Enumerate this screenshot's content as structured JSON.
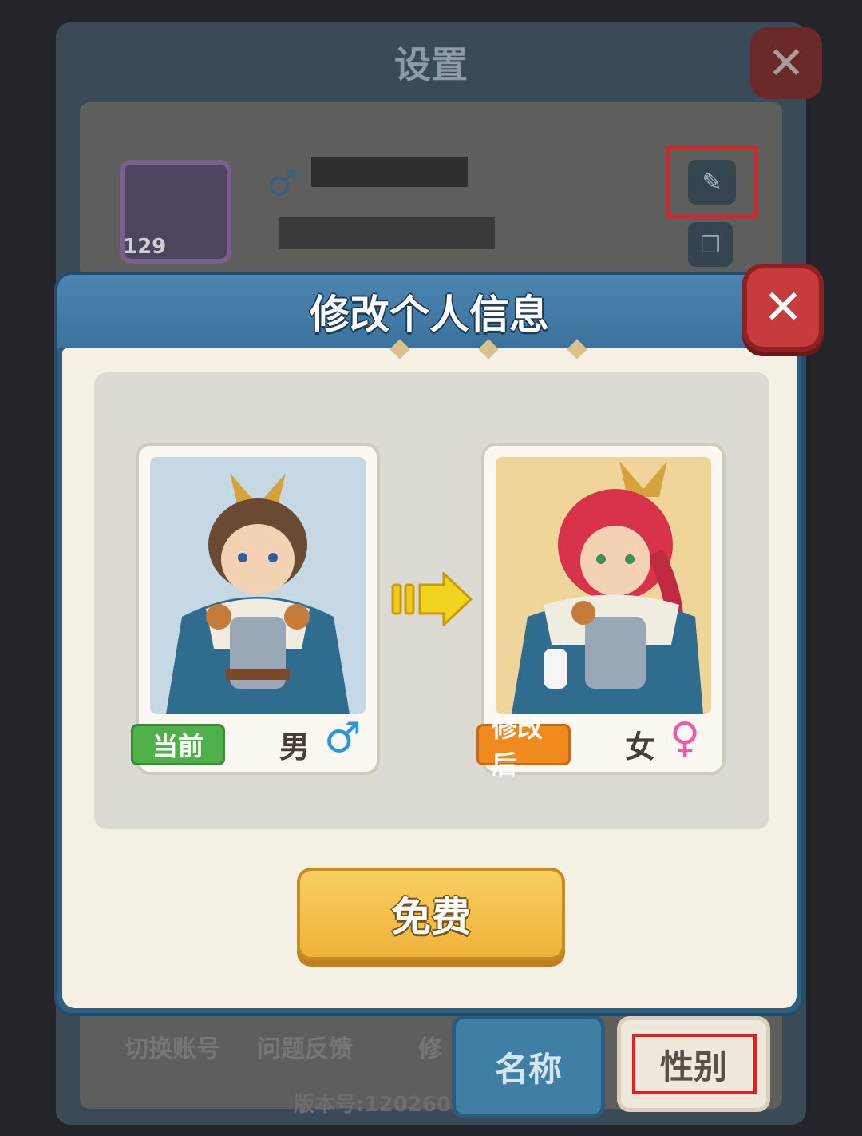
{
  "background_settings": {
    "title": "设置",
    "close_icon": "close-icon",
    "player_level": "129",
    "gender_icon": "♂",
    "bottom_links": [
      "切换账号",
      "问题反馈",
      "修"
    ],
    "version": "版本号:120260"
  },
  "tabs": {
    "name_label": "名称",
    "gender_label": "性别"
  },
  "modal": {
    "title": "修改个人信息",
    "close_icon": "close-icon",
    "current": {
      "badge": "当前",
      "gender": "男",
      "gender_symbol": "♂"
    },
    "after": {
      "badge": "修改后",
      "gender": "女",
      "gender_symbol": "♀"
    },
    "action_button": "免费"
  },
  "colors": {
    "header_blue": "#3a729d",
    "button_gold": "#efb23a",
    "badge_green": "#4fb04a",
    "badge_orange": "#f08a1e",
    "male_blue": "#2a96df",
    "female_pink": "#ee5aa6",
    "highlight_red": "#e51e1e"
  }
}
